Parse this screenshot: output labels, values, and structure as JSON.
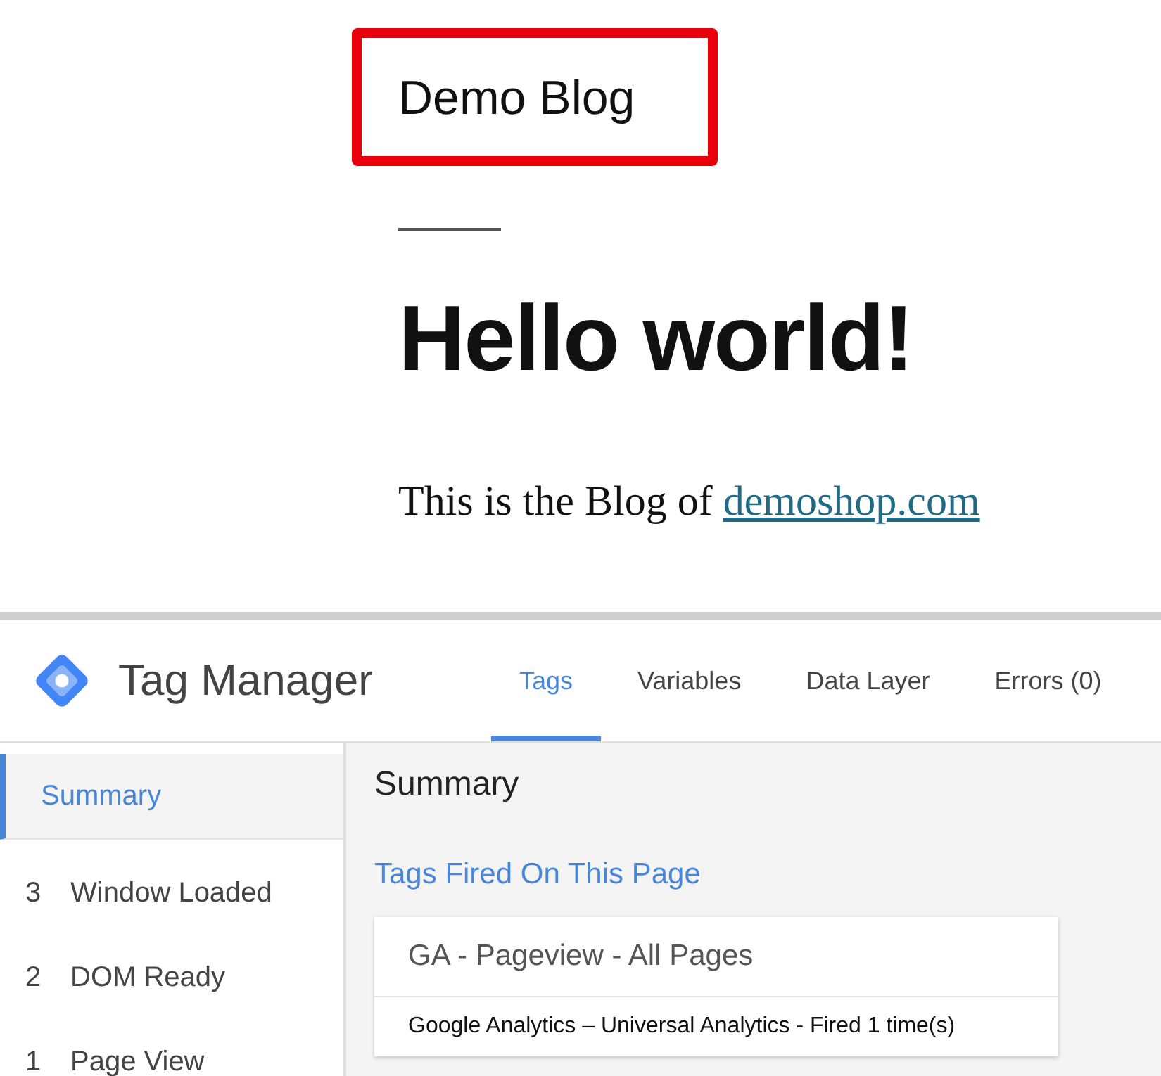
{
  "blog": {
    "site_title": "Demo Blog",
    "post_title": "Hello world!",
    "intro": "This is the Blog of",
    "link": "demoshop.com"
  },
  "tag_manager": {
    "product_name": "Tag Manager",
    "tabs": [
      {
        "label": "Tags",
        "selected": true
      },
      {
        "label": "Variables",
        "selected": false
      },
      {
        "label": "Data Layer",
        "selected": false
      },
      {
        "label": "Errors (0)",
        "selected": false
      }
    ],
    "sidebar": {
      "items": [
        {
          "label": "Summary",
          "selected": true
        },
        {
          "number": "3",
          "label": "Window Loaded",
          "selected": false
        },
        {
          "number": "2",
          "label": "DOM Ready",
          "selected": false
        },
        {
          "number": "1",
          "label": "Page View",
          "selected": false
        }
      ]
    },
    "main": {
      "title": "Summary",
      "section_title": "Tags Fired On This Page",
      "tags": [
        {
          "name": "GA - Pageview - All Pages",
          "detail": "Google Analytics – Universal Analytics - Fired 1 time(s)"
        }
      ]
    }
  }
}
